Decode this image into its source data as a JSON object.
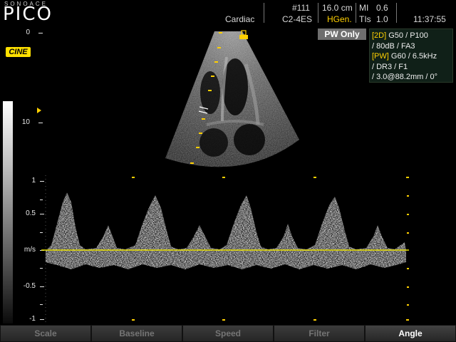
{
  "brand": {
    "small": "SONOACE",
    "main": "PICO"
  },
  "header": {
    "preset": "Cardiac",
    "image_num": "#111",
    "probe": "C2-4ES",
    "depth": "16.0 cm",
    "freq_mode": "HGen.",
    "mi_label": "MI",
    "mi_value": "0.6",
    "tis_label": "TIs",
    "tis_value": "1.0",
    "time": "11:37:55"
  },
  "cine_label": "CINE",
  "depth_scale": {
    "ticks": [
      "0",
      "10"
    ]
  },
  "mode_badge": "PW Only",
  "params": {
    "line1_tag": "[2D]",
    "line1": "G50 / P100",
    "line2": "/ 80dB / FA3",
    "line3_tag": "[PW]",
    "line3": "G60 / 6.5kHz",
    "line4": "/ DR3 / F1",
    "line5": "/ 3.0@88.2mm / 0°"
  },
  "doppler_scale": {
    "unit": "m/s",
    "ticks": [
      "1",
      "0.5",
      "-0.5",
      "-1"
    ]
  },
  "menu": [
    {
      "label": "Scale",
      "active": false
    },
    {
      "label": "Baseline",
      "active": false
    },
    {
      "label": "Speed",
      "active": false
    },
    {
      "label": "Filter",
      "active": false
    },
    {
      "label": "Angle",
      "active": true
    }
  ],
  "colors": {
    "accent": "#ffd000",
    "baseline": "#e8e000"
  }
}
